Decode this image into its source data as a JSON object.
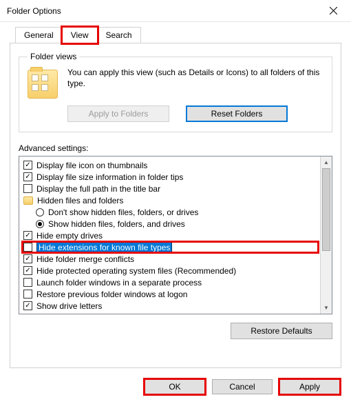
{
  "window": {
    "title": "Folder Options"
  },
  "tabs": {
    "general": "General",
    "view": "View",
    "search": "Search"
  },
  "folder_views": {
    "legend": "Folder views",
    "desc": "You can apply this view (such as Details or Icons) to all folders of this type.",
    "apply_btn": "Apply to Folders",
    "reset_btn": "Reset Folders"
  },
  "advanced": {
    "label": "Advanced settings:",
    "items": [
      {
        "kind": "check",
        "checked": true,
        "text": "Display file icon on thumbnails"
      },
      {
        "kind": "check",
        "checked": true,
        "text": "Display file size information in folder tips"
      },
      {
        "kind": "check",
        "checked": false,
        "text": "Display the full path in the title bar"
      },
      {
        "kind": "folder",
        "text": "Hidden files and folders"
      },
      {
        "kind": "radio",
        "checked": false,
        "indent": true,
        "text": "Don't show hidden files, folders, or drives"
      },
      {
        "kind": "radio",
        "checked": true,
        "indent": true,
        "text": "Show hidden files, folders, and drives"
      },
      {
        "kind": "check",
        "checked": true,
        "text": "Hide empty drives"
      },
      {
        "kind": "check",
        "checked": false,
        "text": "Hide extensions for known file types",
        "selected": true,
        "highlight": true
      },
      {
        "kind": "check",
        "checked": true,
        "text": "Hide folder merge conflicts"
      },
      {
        "kind": "check",
        "checked": true,
        "text": "Hide protected operating system files (Recommended)"
      },
      {
        "kind": "check",
        "checked": false,
        "text": "Launch folder windows in a separate process"
      },
      {
        "kind": "check",
        "checked": false,
        "text": "Restore previous folder windows at logon"
      },
      {
        "kind": "check",
        "checked": true,
        "text": "Show drive letters"
      }
    ],
    "restore_btn": "Restore Defaults"
  },
  "footer": {
    "ok": "OK",
    "cancel": "Cancel",
    "apply": "Apply"
  }
}
